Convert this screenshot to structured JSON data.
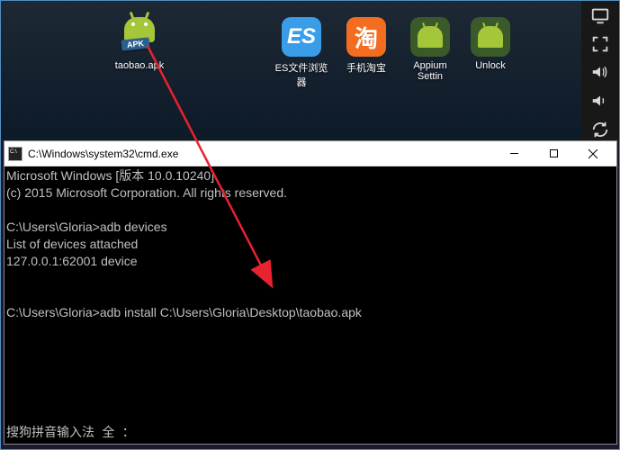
{
  "desktop": {
    "apk_file": {
      "label": "taobao.apk"
    },
    "apps": [
      {
        "label": "ES文件浏览器"
      },
      {
        "label": "手机淘宝"
      },
      {
        "label": "Appium Settin"
      },
      {
        "label": "Unlock"
      }
    ]
  },
  "terminal": {
    "title": "C:\\Windows\\system32\\cmd.exe",
    "lines": {
      "l1": "Microsoft Windows [版本 10.0.10240]",
      "l2": "(c) 2015 Microsoft Corporation. All rights reserved.",
      "l3": "",
      "l4": "C:\\Users\\Gloria>adb devices",
      "l5": "List of devices attached",
      "l6": "127.0.0.1:62001 device",
      "l7": "",
      "l8": "",
      "l9": "C:\\Users\\Gloria>adb install C:\\Users\\Gloria\\Desktop\\taobao.apk"
    },
    "ime": "搜狗拼音输入法 全 ："
  },
  "icons": {
    "apk_badge": "APK",
    "tao": "淘"
  }
}
